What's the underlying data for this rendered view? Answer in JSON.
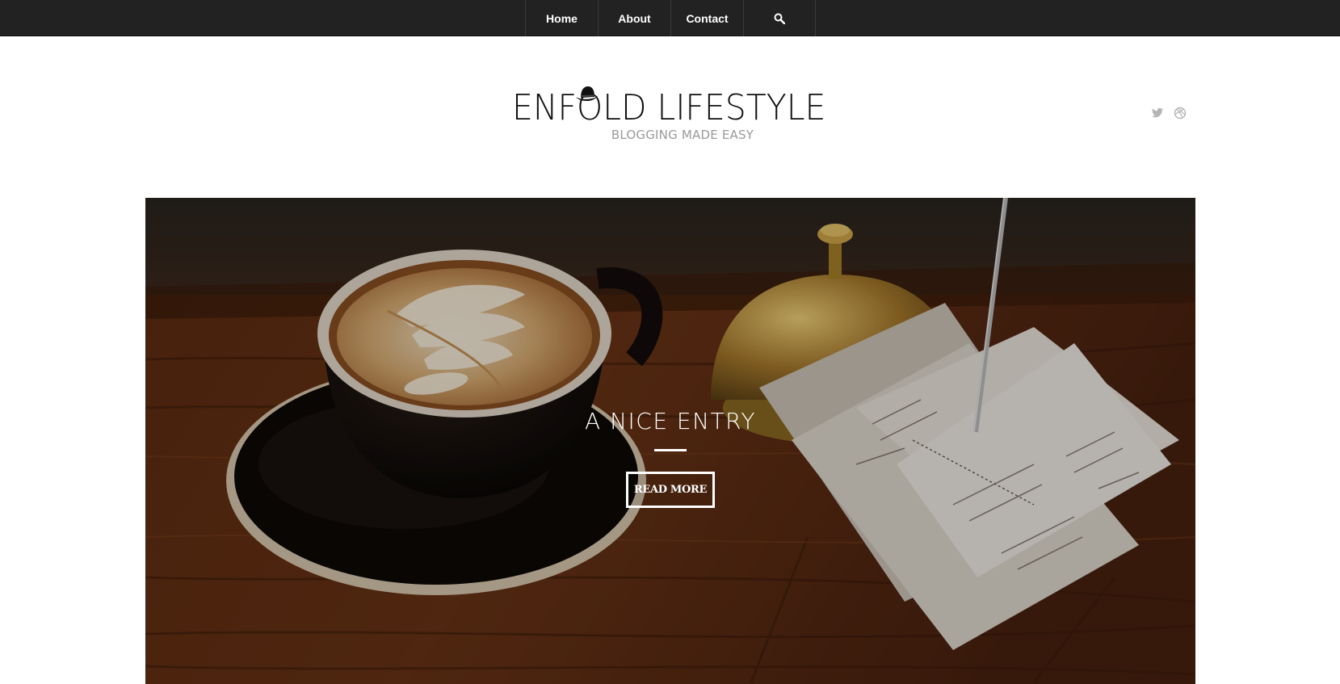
{
  "nav": {
    "items": [
      {
        "label": "Home"
      },
      {
        "label": "About"
      },
      {
        "label": "Contact"
      }
    ],
    "search_icon": "search-icon"
  },
  "header": {
    "logo_title": "ENFOLD LIFESTYLE",
    "logo_tagline": "BLOGGING MADE EASY",
    "logo_icon": "bowler-hat-icon",
    "social": [
      "twitter-icon",
      "dribbble-icon"
    ]
  },
  "hero": {
    "title": "A NICE ENTRY",
    "button_label": "READ MORE"
  },
  "colors": {
    "topbar": "#222222",
    "nav_text": "#ffffff",
    "logo_text": "#111111",
    "tagline": "#9a9a9a",
    "social_icon": "#b5b5b5"
  }
}
